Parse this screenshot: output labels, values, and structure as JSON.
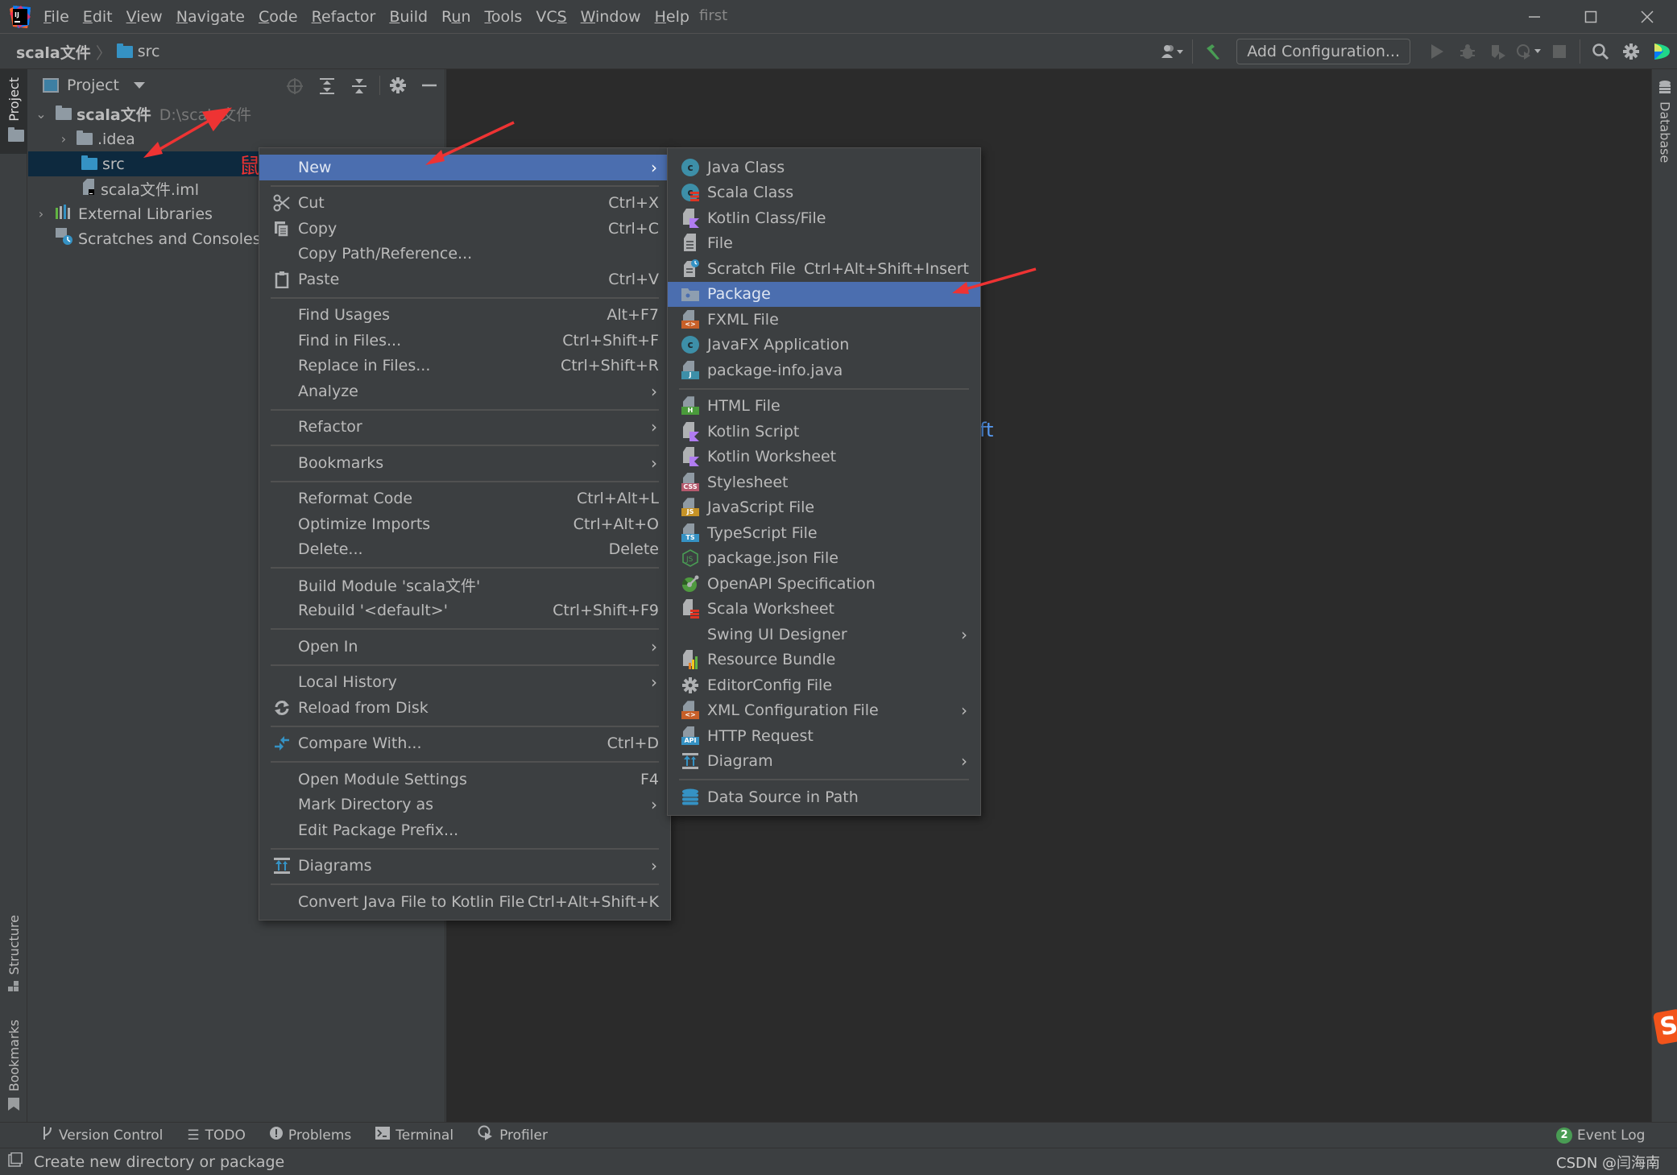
{
  "window": {
    "title": "first",
    "menubar": [
      {
        "label": "File",
        "mnemonic": "F"
      },
      {
        "label": "Edit",
        "mnemonic": "E"
      },
      {
        "label": "View",
        "mnemonic": "V"
      },
      {
        "label": "Navigate",
        "mnemonic": "N"
      },
      {
        "label": "Code",
        "mnemonic": "C"
      },
      {
        "label": "Refactor",
        "mnemonic": "R"
      },
      {
        "label": "Build",
        "mnemonic": "B"
      },
      {
        "label": "Run",
        "mnemonic": "u"
      },
      {
        "label": "Tools",
        "mnemonic": "T"
      },
      {
        "label": "VCS",
        "mnemonic": "S"
      },
      {
        "label": "Window",
        "mnemonic": "W"
      },
      {
        "label": "Help",
        "mnemonic": "H"
      }
    ],
    "controls": {
      "minimize": "—",
      "maximize": "☐",
      "close": "✕"
    }
  },
  "navbar": {
    "breadcrumb_root": "scala文件",
    "breadcrumb_separator": "〉",
    "breadcrumb_current": "src",
    "add_configuration_label": "Add Configuration..."
  },
  "left_strip": {
    "project_tab": "Project",
    "structure_tab": "Structure",
    "bookmarks_tab": "Bookmarks"
  },
  "right_strip": {
    "database_tab": "Database"
  },
  "project_panel": {
    "title": "Project",
    "tree": [
      {
        "label": "scala文件",
        "hint": "D:\\scala文件",
        "expanded": true,
        "bold": true
      },
      {
        "label": ".idea",
        "expanded": false
      },
      {
        "label": "src",
        "selected": true
      },
      {
        "label": "scala文件.iml"
      },
      {
        "label": "External Libraries",
        "expanded": false
      },
      {
        "label": "Scratches and Consoles"
      }
    ]
  },
  "annotations": {
    "right_click_note": "鼠标右击",
    "arrow_color": "#ee3333"
  },
  "editor": {
    "fragment_text": "ft"
  },
  "context_menu": {
    "items": [
      {
        "label": "New",
        "has_submenu": true,
        "highlighted": true
      },
      {
        "separator": true
      },
      {
        "label": "Cut",
        "shortcut": "Ctrl+X",
        "icon": "scissors-icon"
      },
      {
        "label": "Copy",
        "shortcut": "Ctrl+C",
        "icon": "copy-icon"
      },
      {
        "label": "Copy Path/Reference..."
      },
      {
        "label": "Paste",
        "shortcut": "Ctrl+V",
        "icon": "clipboard-icon"
      },
      {
        "separator": true
      },
      {
        "label": "Find Usages",
        "shortcut": "Alt+F7"
      },
      {
        "label": "Find in Files...",
        "shortcut": "Ctrl+Shift+F"
      },
      {
        "label": "Replace in Files...",
        "shortcut": "Ctrl+Shift+R"
      },
      {
        "label": "Analyze",
        "has_submenu": true
      },
      {
        "separator": true
      },
      {
        "label": "Refactor",
        "has_submenu": true
      },
      {
        "separator": true
      },
      {
        "label": "Bookmarks",
        "has_submenu": true
      },
      {
        "separator": true
      },
      {
        "label": "Reformat Code",
        "shortcut": "Ctrl+Alt+L"
      },
      {
        "label": "Optimize Imports",
        "shortcut": "Ctrl+Alt+O"
      },
      {
        "label": "Delete...",
        "shortcut": "Delete"
      },
      {
        "separator": true
      },
      {
        "label": "Build Module 'scala文件'"
      },
      {
        "label": "Rebuild '<default>'",
        "shortcut": "Ctrl+Shift+F9"
      },
      {
        "separator": true
      },
      {
        "label": "Open In",
        "has_submenu": true
      },
      {
        "separator": true
      },
      {
        "label": "Local History",
        "has_submenu": true
      },
      {
        "label": "Reload from Disk",
        "icon": "reload-icon"
      },
      {
        "separator": true
      },
      {
        "label": "Compare With...",
        "shortcut": "Ctrl+D",
        "icon": "compare-icon"
      },
      {
        "separator": true
      },
      {
        "label": "Open Module Settings",
        "shortcut": "F4"
      },
      {
        "label": "Mark Directory as",
        "has_submenu": true
      },
      {
        "label": "Edit Package Prefix..."
      },
      {
        "separator": true
      },
      {
        "label": "Diagrams",
        "has_submenu": true,
        "icon": "diagram-icon"
      },
      {
        "separator": true
      },
      {
        "label": "Convert Java File to Kotlin File",
        "shortcut": "Ctrl+Alt+Shift+K"
      }
    ]
  },
  "new_submenu": {
    "items": [
      {
        "label": "Java Class",
        "icon": "java-class-icon"
      },
      {
        "label": "Scala Class",
        "icon": "scala-class-icon"
      },
      {
        "label": "Kotlin Class/File",
        "icon": "kotlin-file-icon"
      },
      {
        "label": "File",
        "icon": "file-icon"
      },
      {
        "label": "Scratch File",
        "shortcut": "Ctrl+Alt+Shift+Insert",
        "icon": "scratch-file-icon"
      },
      {
        "label": "Package",
        "highlighted": true,
        "icon": "package-icon"
      },
      {
        "label": "FXML File",
        "icon": "fxml-file-icon"
      },
      {
        "label": "JavaFX Application",
        "icon": "javafx-app-icon"
      },
      {
        "label": "package-info.java",
        "icon": "package-info-icon"
      },
      {
        "separator": true
      },
      {
        "label": "HTML File",
        "icon": "html-file-icon"
      },
      {
        "label": "Kotlin Script",
        "icon": "kotlin-script-icon"
      },
      {
        "label": "Kotlin Worksheet",
        "icon": "kotlin-worksheet-icon"
      },
      {
        "label": "Stylesheet",
        "icon": "css-file-icon"
      },
      {
        "label": "JavaScript File",
        "icon": "js-file-icon"
      },
      {
        "label": "TypeScript File",
        "icon": "ts-file-icon"
      },
      {
        "label": "package.json File",
        "icon": "nodejs-icon"
      },
      {
        "label": "OpenAPI Specification",
        "icon": "openapi-icon"
      },
      {
        "label": "Scala Worksheet",
        "icon": "scala-worksheet-icon"
      },
      {
        "label": "Swing UI Designer",
        "has_submenu": true
      },
      {
        "label": "Resource Bundle",
        "icon": "resource-bundle-icon"
      },
      {
        "label": "EditorConfig File",
        "icon": "gear-icon"
      },
      {
        "label": "XML Configuration File",
        "has_submenu": true,
        "icon": "xml-file-icon"
      },
      {
        "label": "HTTP Request",
        "icon": "http-request-icon"
      },
      {
        "label": "Diagram",
        "has_submenu": true,
        "icon": "diagram-icon"
      },
      {
        "separator": true
      },
      {
        "label": "Data Source in Path",
        "icon": "database-icon"
      }
    ]
  },
  "bottom_bar": {
    "tabs": [
      {
        "label": "Version Control",
        "icon": "vcs-branch-icon"
      },
      {
        "label": "TODO",
        "icon": "list-icon"
      },
      {
        "label": "Problems",
        "icon": "problems-icon"
      },
      {
        "label": "Terminal",
        "icon": "terminal-icon"
      },
      {
        "label": "Profiler",
        "icon": "profiler-icon"
      }
    ],
    "event_log_label": "Event Log",
    "event_log_count": "2"
  },
  "status_bar": {
    "message": "Create new directory or package",
    "watermark": "CSDN @闫海南"
  },
  "colors": {
    "selection": "#4b6eaf",
    "tree_selection": "#0d293e",
    "accent_folder": "#3592c4",
    "annotation_red": "#ee3333"
  }
}
